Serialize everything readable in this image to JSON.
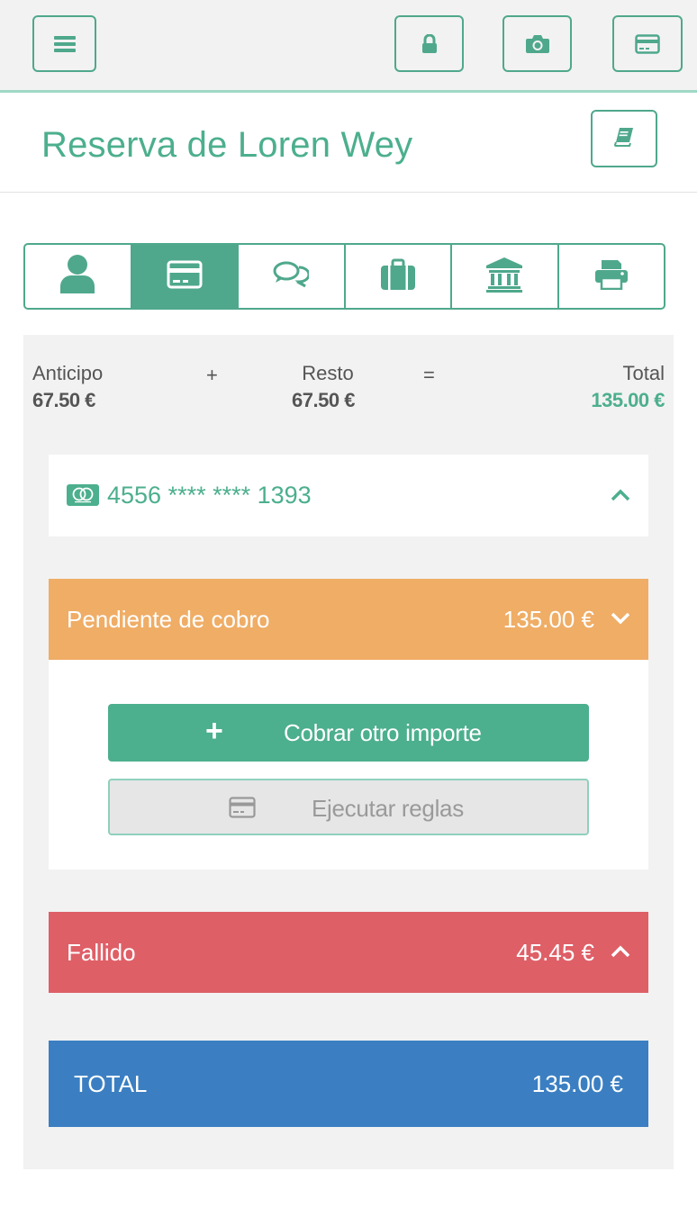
{
  "topbar": {
    "icons": [
      "menu-icon",
      "lock-icon",
      "camera-icon",
      "credit-card-icon"
    ]
  },
  "header": {
    "title": "Reserva de Loren Wey",
    "book_icon": "book-icon"
  },
  "tabs": [
    {
      "icon": "user-icon",
      "active": false
    },
    {
      "icon": "credit-card-icon",
      "active": true
    },
    {
      "icon": "comments-icon",
      "active": false
    },
    {
      "icon": "suitcase-icon",
      "active": false
    },
    {
      "icon": "bank-icon",
      "active": false
    },
    {
      "icon": "print-icon",
      "active": false
    }
  ],
  "summary": {
    "anticipo_label": "Anticipo",
    "anticipo_value": "67.50 €",
    "plus": "+",
    "resto_label": "Resto",
    "resto_value": "67.50 €",
    "equals": "=",
    "total_label": "Total",
    "total_value": "135.00 €"
  },
  "card": {
    "brand_icon": "mastercard-icon",
    "number": "4556 **** **** 1393"
  },
  "pending": {
    "label": "Pendiente de cobro",
    "amount": "135.00 €",
    "cobrar_label": "Cobrar otro importe",
    "reglas_label": "Ejecutar reglas"
  },
  "failed": {
    "label": "Fallido",
    "amount": "45.45 €"
  },
  "total": {
    "label": "TOTAL",
    "amount": "135.00 €"
  },
  "colors": {
    "accent": "#4caf8d",
    "pending": "#efad66",
    "failed": "#df5f67",
    "total": "#3b7fc2"
  }
}
